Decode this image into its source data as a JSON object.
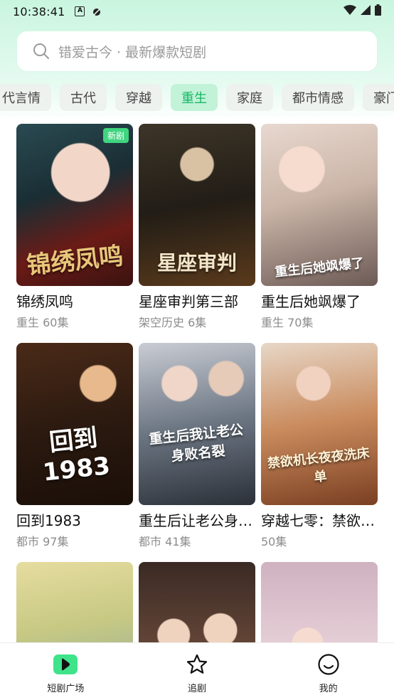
{
  "status_bar": {
    "time": "10:38:41",
    "icons": [
      "a-icon",
      "app-icon",
      "wifi-icon",
      "signal-icon",
      "battery-icon"
    ]
  },
  "search": {
    "placeholder": "错爱古今 · 最新爆款短剧"
  },
  "categories": [
    {
      "label": "代言情",
      "active": false
    },
    {
      "label": "古代",
      "active": false
    },
    {
      "label": "穿越",
      "active": false
    },
    {
      "label": "重生",
      "active": true
    },
    {
      "label": "家庭",
      "active": false
    },
    {
      "label": "都市情感",
      "active": false
    },
    {
      "label": "豪门",
      "active": false
    }
  ],
  "dramas": [
    {
      "title": "锦绣凤鸣",
      "meta": "重生 60集",
      "badge": "新剧",
      "poster_text": "锦绣凤鸣"
    },
    {
      "title": "星座审判第三部",
      "meta": "架空历史 6集",
      "badge": "",
      "poster_text": "星座审判"
    },
    {
      "title": "重生后她飒爆了",
      "meta": "重生 70集",
      "badge": "",
      "poster_text": "重生后她飒爆了"
    },
    {
      "title": "回到1983",
      "meta": "都市 97集",
      "badge": "",
      "poster_text": "回到1983"
    },
    {
      "title": "重生后让老公身…",
      "meta": "都市 41集",
      "badge": "",
      "poster_text": "重生后我让老公身败名裂"
    },
    {
      "title": "穿越七零：禁欲…",
      "meta": " 50集",
      "badge": "",
      "poster_text": "禁欲机长夜夜洗床单"
    },
    {
      "title": "",
      "meta": "",
      "badge": "",
      "poster_text": ""
    },
    {
      "title": "",
      "meta": "",
      "badge": "",
      "poster_text": ""
    },
    {
      "title": "",
      "meta": "",
      "badge": "",
      "poster_text": ""
    }
  ],
  "bottom_nav": [
    {
      "label": "短剧广场",
      "icon": "play-icon",
      "active": true
    },
    {
      "label": "追剧",
      "icon": "star-icon",
      "active": false
    },
    {
      "label": "我的",
      "icon": "smile-icon",
      "active": false
    }
  ],
  "colors": {
    "accent": "#15b866",
    "active_chip_bg": "#c2f2d8",
    "badge": "#3fd57f"
  }
}
